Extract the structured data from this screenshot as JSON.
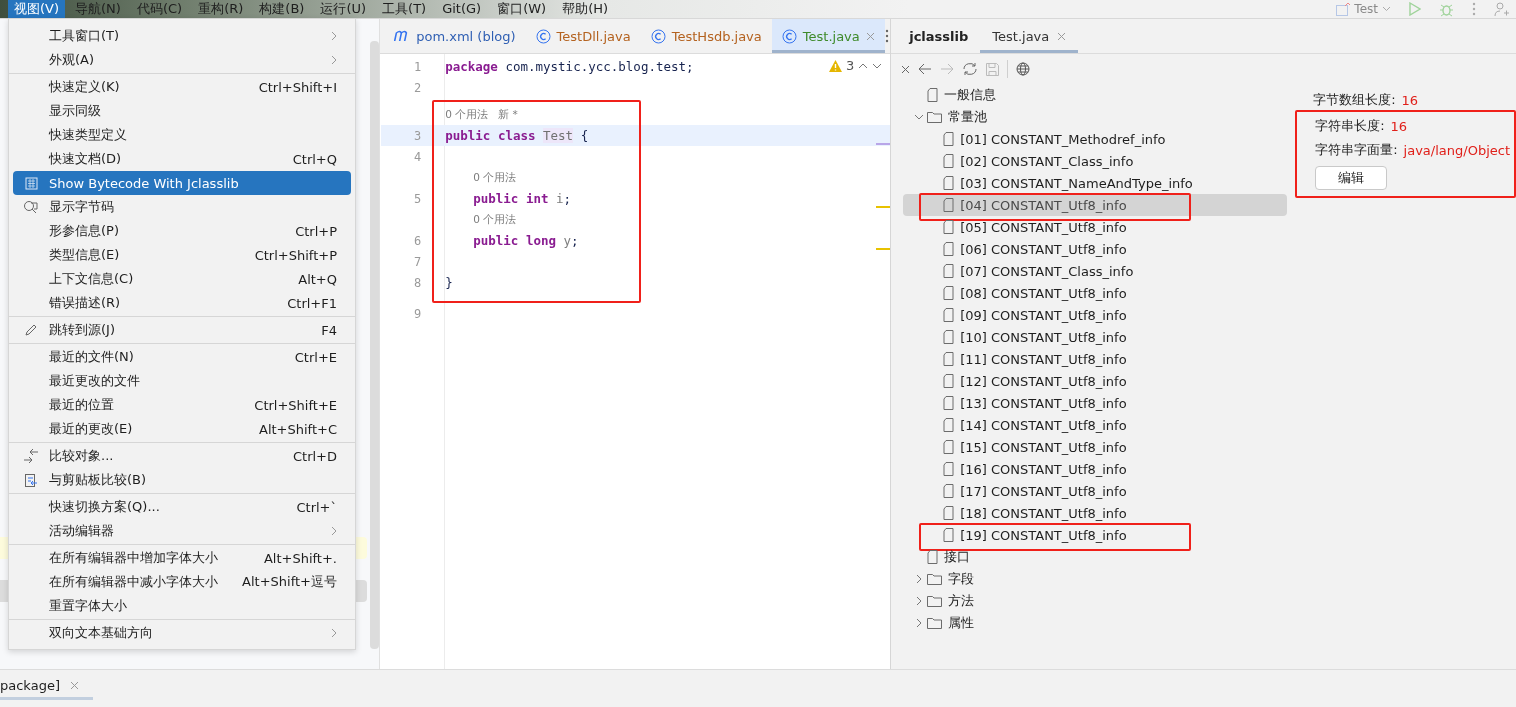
{
  "menu_bar": [
    {
      "label": "视图(V)",
      "selected": true
    },
    {
      "label": "导航(N)",
      "selected": false
    },
    {
      "label": "代码(C)",
      "selected": false
    },
    {
      "label": "重构(R)",
      "selected": false
    },
    {
      "label": "构建(B)",
      "selected": false
    },
    {
      "label": "运行(U)",
      "selected": false
    },
    {
      "label": "工具(T)",
      "selected": false
    },
    {
      "label": "Git(G)",
      "selected": false
    },
    {
      "label": "窗口(W)",
      "selected": false
    },
    {
      "label": "帮助(H)",
      "selected": false
    }
  ],
  "run_config": {
    "label": "Test"
  },
  "dropdown_menu": [
    {
      "kind": "item",
      "label": "工具窗口(T)",
      "submenu": true,
      "selected": false
    },
    {
      "kind": "item",
      "label": "外观(A)",
      "submenu": true,
      "selected": false
    },
    {
      "kind": "separator"
    },
    {
      "kind": "item",
      "label": "快速定义(K)",
      "shortcut": "Ctrl+Shift+I",
      "selected": false
    },
    {
      "kind": "item",
      "label": "显示同级",
      "selected": false
    },
    {
      "kind": "item",
      "label": "快速类型定义",
      "selected": false
    },
    {
      "kind": "item",
      "label": "快速文档(D)",
      "shortcut": "Ctrl+Q",
      "selected": false
    },
    {
      "kind": "item",
      "label": "Show Bytecode With Jclasslib",
      "selected": true
    },
    {
      "kind": "item",
      "label": "显示字节码",
      "selected": false
    },
    {
      "kind": "item",
      "label": "形参信息(P)",
      "shortcut": "Ctrl+P",
      "selected": false
    },
    {
      "kind": "item",
      "label": "类型信息(E)",
      "shortcut": "Ctrl+Shift+P",
      "selected": false
    },
    {
      "kind": "item",
      "label": "上下文信息(C)",
      "shortcut": "Alt+Q",
      "selected": false
    },
    {
      "kind": "item",
      "label": "错误描述(R)",
      "shortcut": "Ctrl+F1",
      "selected": false
    },
    {
      "kind": "separator"
    },
    {
      "kind": "item",
      "label": "跳转到源(J)",
      "shortcut": "F4",
      "selected": false
    },
    {
      "kind": "separator"
    },
    {
      "kind": "item",
      "label": "最近的文件(N)",
      "shortcut": "Ctrl+E",
      "selected": false
    },
    {
      "kind": "item",
      "label": "最近更改的文件",
      "selected": false
    },
    {
      "kind": "item",
      "label": "最近的位置",
      "shortcut": "Ctrl+Shift+E",
      "selected": false
    },
    {
      "kind": "item",
      "label": "最近的更改(E)",
      "shortcut": "Alt+Shift+C",
      "selected": false
    },
    {
      "kind": "separator"
    },
    {
      "kind": "item",
      "label": "比较对象...",
      "shortcut": "Ctrl+D",
      "selected": false
    },
    {
      "kind": "item",
      "label": "与剪贴板比较(B)",
      "selected": false
    },
    {
      "kind": "separator"
    },
    {
      "kind": "item",
      "label": "快速切换方案(Q)...",
      "shortcut": "Ctrl+`",
      "selected": false
    },
    {
      "kind": "item",
      "label": "活动编辑器",
      "submenu": true,
      "selected": false
    },
    {
      "kind": "separator"
    },
    {
      "kind": "item",
      "label": "在所有编辑器中增加字体大小",
      "shortcut": "Alt+Shift+.",
      "selected": false
    },
    {
      "kind": "item",
      "label": "在所有编辑器中减小字体大小",
      "shortcut": "Alt+Shift+逗号",
      "selected": false
    },
    {
      "kind": "item",
      "label": "重置字体大小",
      "selected": false
    },
    {
      "kind": "separator"
    },
    {
      "kind": "item",
      "label": "双向文本基础方向",
      "submenu": true,
      "selected": false
    }
  ],
  "editor": {
    "tabs": [
      {
        "label": "pom.xml (blog)",
        "color": "#2f5fb3",
        "selected": false
      },
      {
        "label": "TestDll.java",
        "color": "#b4621f",
        "selected": false
      },
      {
        "label": "TestHsdb.java",
        "color": "#b4621f",
        "selected": false
      },
      {
        "label": "Test.java",
        "color": "#3e8a2a",
        "selected": true
      }
    ],
    "warnings": "3",
    "lines": [
      {
        "kind": "line",
        "number": "1",
        "tokens": [
          {
            "kind": "keyword",
            "text": "package"
          },
          {
            "kind": "text",
            "text": " com.mystic.ycc.blog.test;"
          }
        ]
      },
      {
        "kind": "line",
        "number": "2"
      },
      {
        "kind": "framed",
        "lines": [
          {
            "kind": "hint",
            "text": "0 个用法   新 *"
          },
          {
            "kind": "line",
            "number": "3",
            "current": true,
            "tokens": [
              {
                "kind": "keyword",
                "text": "public class "
              },
              {
                "kind": "declaration",
                "text": "Test"
              },
              {
                "kind": "text",
                "text": " {"
              }
            ]
          },
          {
            "kind": "line",
            "number": "4"
          },
          {
            "kind": "hint",
            "text": "0 个用法",
            "indented": true
          },
          {
            "kind": "line",
            "number": "5",
            "indented": true,
            "tokens": [
              {
                "kind": "keyword",
                "text": "public int"
              },
              {
                "kind": "unused",
                "text": " i"
              },
              {
                "kind": "text",
                "text": ";"
              }
            ]
          },
          {
            "kind": "hint",
            "text": "0 个用法",
            "indented": true
          },
          {
            "kind": "line",
            "number": "6",
            "indented": true,
            "tokens": [
              {
                "kind": "keyword",
                "text": "public long"
              },
              {
                "kind": "unused",
                "text": " y"
              },
              {
                "kind": "text",
                "text": ";"
              }
            ]
          },
          {
            "kind": "line",
            "number": "7"
          },
          {
            "kind": "line",
            "number": "8",
            "tokens": [
              {
                "kind": "text",
                "text": "}"
              }
            ]
          }
        ]
      },
      {
        "kind": "line",
        "number": "9"
      }
    ]
  },
  "jclasslib": {
    "tabs": [
      {
        "label": "jclasslib",
        "closable": false,
        "selected": false
      },
      {
        "label": "Test.java",
        "closable": true,
        "selected": true
      }
    ],
    "tree": [
      {
        "label": "一般信息",
        "kind": "file",
        "selected": false
      },
      {
        "label": "常量池",
        "kind": "folder",
        "expanded": true,
        "selected": false,
        "children": [
          {
            "label": "[01] CONSTANT_Methodref_info",
            "kind": "file",
            "selected": false
          },
          {
            "label": "[02] CONSTANT_Class_info",
            "kind": "file",
            "selected": false
          },
          {
            "label": "[03] CONSTANT_NameAndType_info",
            "kind": "file",
            "selected": false
          },
          {
            "label": "[04] CONSTANT_Utf8_info",
            "kind": "file",
            "selected": true,
            "framed": true
          },
          {
            "label": "[05] CONSTANT_Utf8_info",
            "kind": "file",
            "selected": false
          },
          {
            "label": "[06] CONSTANT_Utf8_info",
            "kind": "file",
            "selected": false
          },
          {
            "label": "[07] CONSTANT_Class_info",
            "kind": "file",
            "selected": false
          },
          {
            "label": "[08] CONSTANT_Utf8_info",
            "kind": "file",
            "selected": false
          },
          {
            "label": "[09] CONSTANT_Utf8_info",
            "kind": "file",
            "selected": false
          },
          {
            "label": "[10] CONSTANT_Utf8_info",
            "kind": "file",
            "selected": false
          },
          {
            "label": "[11] CONSTANT_Utf8_info",
            "kind": "file",
            "selected": false
          },
          {
            "label": "[12] CONSTANT_Utf8_info",
            "kind": "file",
            "selected": false
          },
          {
            "label": "[13] CONSTANT_Utf8_info",
            "kind": "file",
            "selected": false
          },
          {
            "label": "[14] CONSTANT_Utf8_info",
            "kind": "file",
            "selected": false
          },
          {
            "label": "[15] CONSTANT_Utf8_info",
            "kind": "file",
            "selected": false
          },
          {
            "label": "[16] CONSTANT_Utf8_info",
            "kind": "file",
            "selected": false
          },
          {
            "label": "[17] CONSTANT_Utf8_info",
            "kind": "file",
            "selected": false
          },
          {
            "label": "[18] CONSTANT_Utf8_info",
            "kind": "file",
            "selected": false
          },
          {
            "label": "[19] CONSTANT_Utf8_info",
            "kind": "file",
            "selected": false,
            "framed": true
          }
        ]
      },
      {
        "label": "接口",
        "kind": "file",
        "selected": false
      },
      {
        "label": "字段",
        "kind": "folder",
        "expanded": false,
        "selected": false
      },
      {
        "label": "方法",
        "kind": "folder",
        "expanded": false,
        "selected": false
      },
      {
        "label": "属性",
        "kind": "folder",
        "expanded": false,
        "selected": false
      }
    ],
    "details": [
      {
        "label": "字节数组长度:",
        "value": "16"
      }
    ],
    "framed_details": {
      "rows": [
        {
          "label": "字符串长度:",
          "value": "16"
        },
        {
          "label": "字符串字面量:",
          "value": "java/lang/Object"
        }
      ],
      "edit_button": "编辑"
    }
  },
  "bottom_tab": {
    "label": "package]"
  }
}
